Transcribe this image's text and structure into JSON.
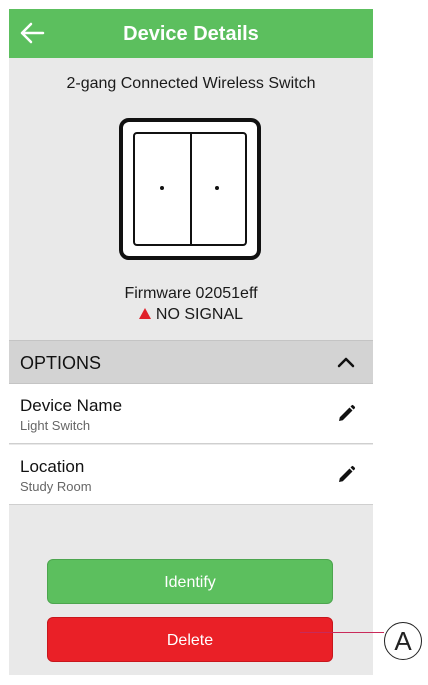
{
  "header": {
    "title": "Device Details",
    "back_icon": "arrow-left-icon"
  },
  "device": {
    "name": "2-gang Connected Wireless Switch",
    "firmware": "Firmware 02051eff",
    "signal_status": "NO SIGNAL",
    "signal_color": "#e0202a"
  },
  "options": {
    "label": "OPTIONS",
    "items": [
      {
        "title": "Device Name",
        "value": "Light Switch",
        "icon": "pencil-icon"
      },
      {
        "title": "Location",
        "value": "Study Room",
        "icon": "pencil-icon"
      }
    ]
  },
  "buttons": {
    "identify": "Identify",
    "delete": "Delete"
  },
  "callout": {
    "label": "A"
  },
  "colors": {
    "header": "#5cbf5e",
    "identify": "#5cbf5e",
    "delete": "#ea2027",
    "background": "#e9e9e9"
  }
}
